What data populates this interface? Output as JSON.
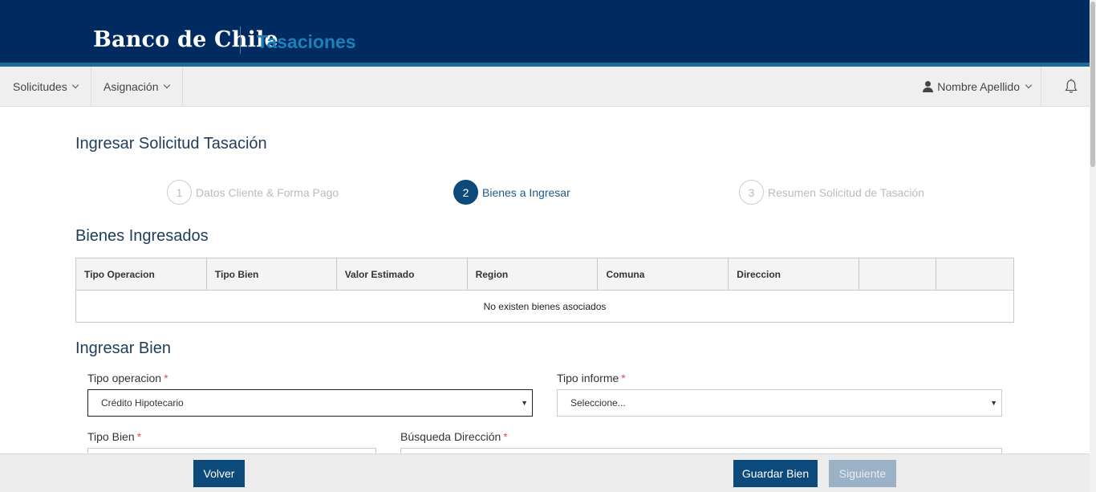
{
  "header": {
    "brand": "Banco de Chile",
    "app_title": "Tasaciones"
  },
  "navbar": {
    "items": [
      {
        "label": "Solicitudes"
      },
      {
        "label": "Asignación"
      }
    ],
    "user_name": "Nombre Apellido"
  },
  "page": {
    "title": "Ingresar Solicitud Tasación"
  },
  "stepper": {
    "steps": [
      {
        "number": "1",
        "label": "Datos Cliente & Forma Pago",
        "state": "inactive"
      },
      {
        "number": "2",
        "label": "Bienes a Ingresar",
        "state": "active"
      },
      {
        "number": "3",
        "label": "Resumen Solicitud de Tasación",
        "state": "inactive"
      }
    ]
  },
  "bienes_ingresados": {
    "title": "Bienes Ingresados",
    "columns": [
      "Tipo Operacion",
      "Tipo Bien",
      "Valor Estimado",
      "Region",
      "Comuna",
      "Direccion",
      "",
      ""
    ],
    "empty_message": "No existen bienes asociados"
  },
  "ingresar_bien": {
    "title": "Ingresar Bien",
    "tipo_operacion": {
      "label": "Tipo operacion",
      "value": "Crédito Hipotecario"
    },
    "tipo_informe": {
      "label": "Tipo informe",
      "value": "Seleccione..."
    },
    "tipo_bien": {
      "label": "Tipo Bien"
    },
    "busqueda_direccion": {
      "label": "Búsqueda Dirección"
    },
    "required_mark": "*"
  },
  "footer": {
    "volver": "Volver",
    "guardar": "Guardar Bien",
    "siguiente": "Siguiente"
  },
  "colors": {
    "header_bg": "#002b61",
    "accent": "#1f7fb8",
    "primary_button": "#0c4a7c",
    "disabled_button": "#9bb1c6",
    "required": "#d9534f"
  }
}
